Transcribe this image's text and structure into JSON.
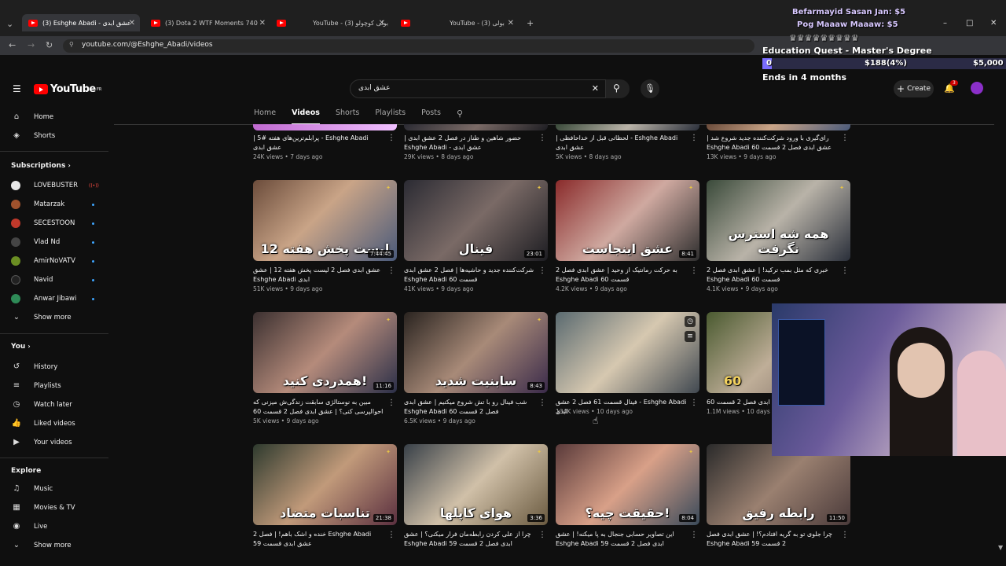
{
  "browser": {
    "tabs": [
      {
        "label": "(3) Eshghe Abadi - عشق ابدی",
        "close": "✕"
      },
      {
        "label": "(3) Dota 2 WTF Moments 740",
        "close": "✕"
      },
      {
        "label": "YouTube - بولی کوچولو (3)",
        "close": "✕"
      },
      {
        "label": "YouTube - بولی (3)",
        "close": "✕"
      }
    ],
    "new_tab": "+",
    "url": "youtube.com/@Eshghe_Abadi/videos"
  },
  "header": {
    "logo_text": "YouTube",
    "logo_region": "FR",
    "search_value": "عشق ابدی",
    "create_label": "Create",
    "notif_count": "3"
  },
  "channel_tabs": [
    "Home",
    "Videos",
    "Shorts",
    "Playlists",
    "Posts"
  ],
  "sidebar": {
    "main": [
      {
        "icon": "⌂",
        "label": "Home"
      },
      {
        "icon": "◈",
        "label": "Shorts"
      }
    ],
    "subscriptions_header": "Subscriptions",
    "subscriptions": [
      {
        "label": "LOVEBUSTER",
        "color": "#e8e8e8"
      },
      {
        "label": "Matarzak",
        "color": "#a0522d"
      },
      {
        "label": "SECESTOON",
        "color": "#c0392b"
      },
      {
        "label": "Vlad Nd",
        "color": "#444444"
      },
      {
        "label": "AmirNoVATV",
        "color": "#6b8e23"
      },
      {
        "label": "Navid",
        "color": "#222222"
      },
      {
        "label": "Anwar Jibawi",
        "color": "#2e8b57"
      }
    ],
    "live_tag": "((•))",
    "show_more": "Show more",
    "you_header": "You",
    "you_items": [
      {
        "icon": "↺",
        "label": "History"
      },
      {
        "icon": "≡",
        "label": "Playlists"
      },
      {
        "icon": "◷",
        "label": "Watch later"
      },
      {
        "icon": "👍",
        "label": "Liked videos"
      },
      {
        "icon": "▶",
        "label": "Your videos"
      }
    ],
    "explore_header": "Explore",
    "explore_items": [
      {
        "icon": "♫",
        "label": "Music"
      },
      {
        "icon": "▦",
        "label": "Movies & TV"
      },
      {
        "icon": "◉",
        "label": "Live"
      }
    ],
    "show_more_2": "Show more"
  },
  "videos_row0": [
    {
      "title": "Eshghe Abadi - پرابلم‌ترین‌های هفته #5 | عشق ابدی",
      "meta": "24K views • 7 days ago"
    },
    {
      "title": "حضور شاهین و طناز در فصل 2 عشق ابدی | عشق ابدی - Eshghe Abadi",
      "meta": "29K views • 8 days ago"
    },
    {
      "title": "Eshghe Abadi - لحظاتی قبل از خداحافظی | عشق ابدی",
      "meta": "5K views • 8 days ago"
    },
    {
      "title": "رای‌گیری با ورود شرکت‌کننده جدید شروع شد | عشق ابدی فصل 2 قسمت 60 Eshghe Abadi",
      "meta": "13K views • 9 days ago"
    }
  ],
  "videos_row1": [
    {
      "title": "عشق ابدی فصل 2 لیست پخش هفته 12 | عشق ابدی Eshghe Abadi",
      "meta": "51K views • 9 days ago",
      "caption": "لیست پخش هفته 12",
      "duration": "7:44:45"
    },
    {
      "title": "شرکت‌کننده جدید و حاشیه‌ها | فصل 2 عشق ابدی قسمت 60 Eshghe Abadi",
      "meta": "41K views • 9 days ago",
      "caption": "فینال",
      "duration": "23:01"
    },
    {
      "title": "به حرکت رمانتیک از وحید | عشق ابدی فصل 2 قسمت 60 Eshghe Abadi",
      "meta": "4.2K views • 9 days ago",
      "caption": "عشق اینجاست",
      "duration": "8:41"
    },
    {
      "title": "خبری که مثل بمب ترکید! | عشق ابدی فصل 2 قسمت 60 Eshghe Abadi",
      "meta": "4.1K views • 9 days ago",
      "caption": "همه شه استرس نگرفت",
      "duration": ""
    }
  ],
  "videos_row2": [
    {
      "title": "مبین به نوستالژی سابقت زندگی‌ش میزنی که احوالپرسی کنی؟ | عشق ابدی فصل 2 قسمت 60 Eshghe Abadi",
      "meta": "5K views • 9 days ago",
      "caption": "همدردی کنید!",
      "duration": "11:16"
    },
    {
      "title": "شب فینال رو با تش شروع میکنیم | عشق ابدی فصل 2 قسمت 60 Eshghe Abadi",
      "meta": "6.5K views • 9 days ago",
      "caption": "سابنیت شدید",
      "duration": "8:43"
    },
    {
      "title": "Eshghe Abadi - فینال قسمت 61 فصل 2 عشق ابدی",
      "meta": "134K views • 10 days ago",
      "caption": "",
      "duration": ""
    },
    {
      "title": "عشق ابدی فصل 2 قسمت 60",
      "meta": "1.1M views • 10 days ago",
      "caption": "60",
      "duration": ""
    }
  ],
  "videos_row3": [
    {
      "title": "Eshghe Abadi خنده و اشک باهم! | فصل 2 عشق ابدی قسمت 59",
      "meta": "",
      "caption": "تناسبات متضاد",
      "duration": "21:38"
    },
    {
      "title": "چرا از علی کردن رابطه‌مان فرار میکنی؟ | عشق ابدی فصل 2 قسمت 59 Eshghe Abadi",
      "meta": "",
      "caption": "هوای کاپلها",
      "duration": "3:36"
    },
    {
      "title": "این تصاویر حسابی جنجال به پا میکنه! | عشق ابدی فصل 2 قسمت 59 Eshghe Abadi",
      "meta": "",
      "caption": "حقیقت چیه؟!",
      "duration": "8:04"
    },
    {
      "title": "چرا جلوی تو به گریه افتادم؟! | عشق ابدی فصل 2 قسمت 59 Eshghe Abadi",
      "meta": "",
      "caption": "رابطه رفیق",
      "duration": "11:50"
    }
  ],
  "overlay": {
    "donation1": "Befarmayid Sasan Jan: $5",
    "donation2": "Pog Maaaw Maaaw: $5",
    "goal_title": "Education Quest - Master's Degree",
    "goal_start": "0",
    "goal_progress": "$188(4%)",
    "goal_target": "$5,000",
    "goal_fraction": 0.04,
    "goal_end": "Ends in 4 months"
  }
}
